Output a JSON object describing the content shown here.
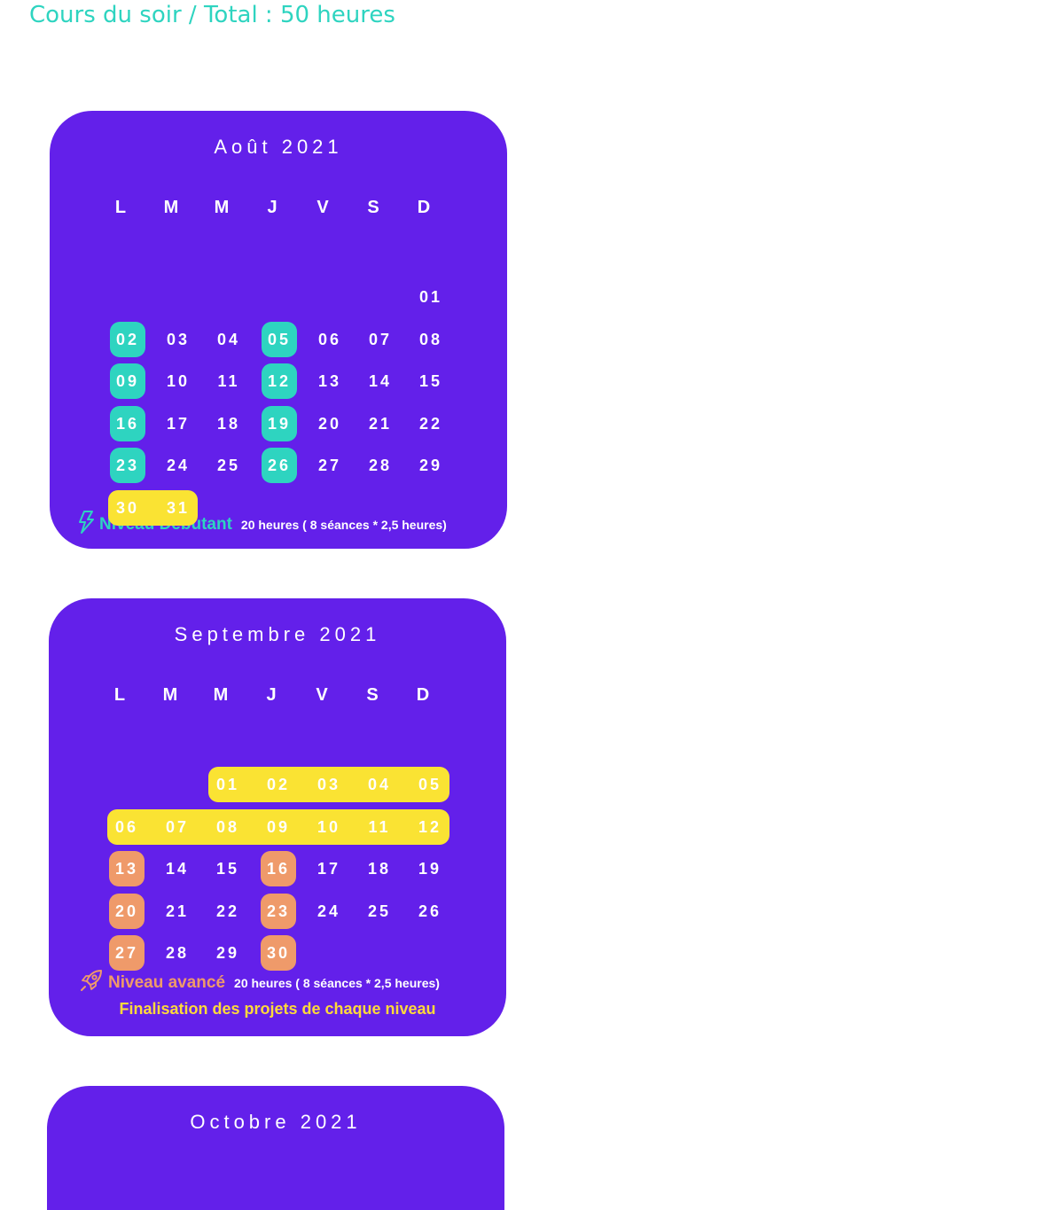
{
  "page_title": "Cours du soir / Total : 50 heures",
  "colors": {
    "card": "#6320ea",
    "teal": "#2ed4c0",
    "yellow": "#fae333",
    "orange": "#ef9a6a",
    "title": "#2ed4c0"
  },
  "weekdays": [
    "L",
    "M",
    "M",
    "J",
    "V",
    "S",
    "D"
  ],
  "months": [
    {
      "id": "aug",
      "title": "Août 2021",
      "first_weekday": 6,
      "days_in_month": 31,
      "highlights": [
        {
          "days": [
            2
          ],
          "color": "teal"
        },
        {
          "days": [
            5
          ],
          "color": "teal"
        },
        {
          "days": [
            9
          ],
          "color": "teal"
        },
        {
          "days": [
            12
          ],
          "color": "teal"
        },
        {
          "days": [
            16
          ],
          "color": "teal"
        },
        {
          "days": [
            19
          ],
          "color": "teal"
        },
        {
          "days": [
            23
          ],
          "color": "teal"
        },
        {
          "days": [
            26
          ],
          "color": "teal"
        },
        {
          "days": [
            30,
            31
          ],
          "color": "yellow"
        }
      ],
      "legend": {
        "icon": "lightning-icon",
        "level": "Niveau Débutant",
        "level_color": "teal",
        "hours": "20 heures ( 8 séances * 2,5 heures)"
      }
    },
    {
      "id": "sep",
      "title": "Septembre 2021",
      "first_weekday": 2,
      "days_in_month": 30,
      "highlights": [
        {
          "days": [
            1,
            2,
            3,
            4,
            5
          ],
          "color": "yellow"
        },
        {
          "days": [
            6,
            7,
            8,
            9,
            10,
            11,
            12
          ],
          "color": "yellow"
        },
        {
          "days": [
            13
          ],
          "color": "orange"
        },
        {
          "days": [
            16
          ],
          "color": "orange"
        },
        {
          "days": [
            20
          ],
          "color": "orange"
        },
        {
          "days": [
            23
          ],
          "color": "orange"
        },
        {
          "days": [
            27
          ],
          "color": "orange"
        },
        {
          "days": [
            30
          ],
          "color": "orange"
        }
      ],
      "legend": {
        "icon": "rocket-icon",
        "level": "Niveau avancé",
        "level_color": "orange",
        "hours": "20 heures ( 8 séances * 2,5 heures)"
      },
      "note": "Finalisation des projets de chaque niveau"
    },
    {
      "id": "oct",
      "title": "Octobre 2021"
    }
  ]
}
